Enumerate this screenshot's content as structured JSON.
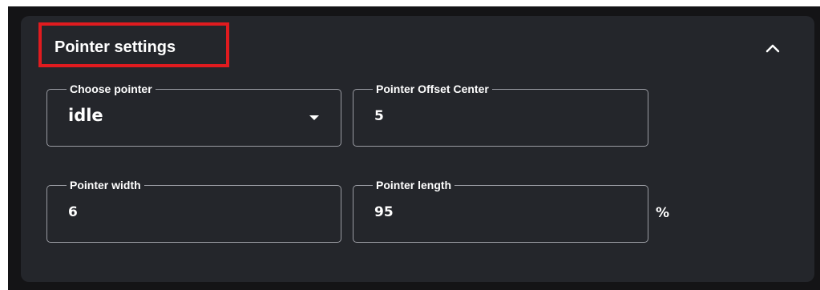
{
  "section": {
    "title": "Pointer settings",
    "collapse_icon": "chevron-up-icon",
    "highlight_color": "#e01b1f"
  },
  "fields": {
    "choose_pointer": {
      "label": "Choose pointer",
      "value": "idle",
      "icon": "caret-down-icon"
    },
    "pointer_offset_center": {
      "label": "Pointer Offset Center",
      "value": "5"
    },
    "pointer_width": {
      "label": "Pointer width",
      "value": "6"
    },
    "pointer_length": {
      "label": "Pointer length",
      "value": "95",
      "unit": "%"
    }
  },
  "colors": {
    "panel_background": "#24262b",
    "outer_background": "#141416",
    "field_border": "#9a9ca3",
    "text": "#ffffff"
  }
}
